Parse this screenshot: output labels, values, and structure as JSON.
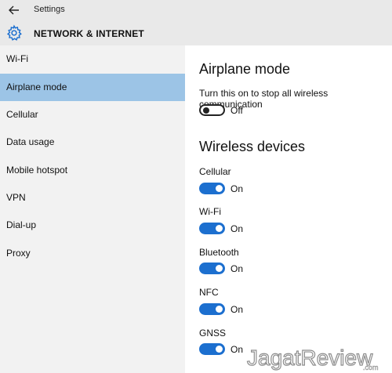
{
  "window": {
    "app_title": "Settings"
  },
  "header": {
    "title": "NETWORK & INTERNET",
    "icon": "gear-icon"
  },
  "sidebar": {
    "items": [
      {
        "label": "Wi-Fi",
        "selected": false
      },
      {
        "label": "Airplane mode",
        "selected": true
      },
      {
        "label": "Cellular",
        "selected": false
      },
      {
        "label": "Data usage",
        "selected": false
      },
      {
        "label": "Mobile hotspot",
        "selected": false
      },
      {
        "label": "VPN",
        "selected": false
      },
      {
        "label": "Dial-up",
        "selected": false
      },
      {
        "label": "Proxy",
        "selected": false
      }
    ]
  },
  "airplane": {
    "title": "Airplane mode",
    "description": "Turn this on to stop all wireless communication",
    "state": "Off"
  },
  "wireless": {
    "title": "Wireless devices",
    "devices": [
      {
        "label": "Cellular",
        "state": "On"
      },
      {
        "label": "Wi-Fi",
        "state": "On"
      },
      {
        "label": "Bluetooth",
        "state": "On"
      },
      {
        "label": "NFC",
        "state": "On"
      },
      {
        "label": "GNSS",
        "state": "On"
      }
    ]
  },
  "watermark": {
    "text": "JagatReview",
    "domain": ".com"
  },
  "colors": {
    "accent": "#1c6fcf",
    "selected_nav": "#9cc4e6",
    "sidebar_bg": "#f2f2f2",
    "header_bg": "#e9e9e9"
  }
}
